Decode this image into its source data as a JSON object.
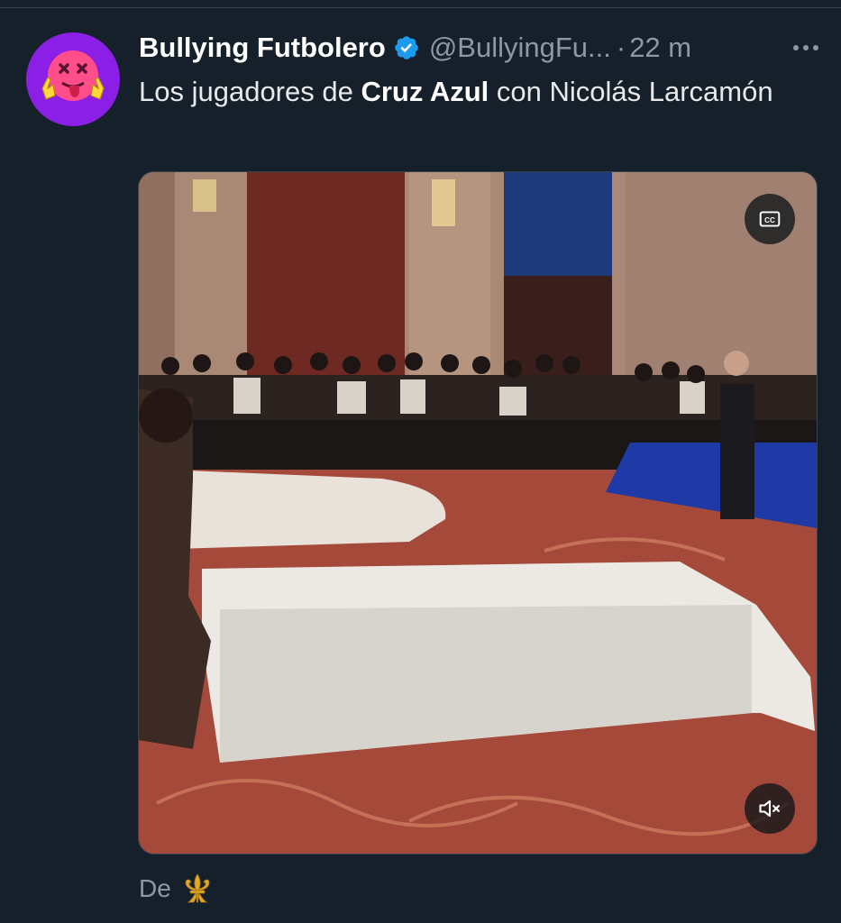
{
  "tweet": {
    "author": {
      "display_name": "Bullying Futbolero",
      "handle": "@BullyingFu...",
      "verified": true,
      "avatar_icon": "dizzy-tongue-face-icon"
    },
    "separator": "·",
    "time": "22 m",
    "text": {
      "part1": "Los jugadores de ",
      "bold": "Cruz Azul",
      "part2": " con Nicolás Larcamón"
    },
    "media": {
      "type": "video",
      "captions_icon": "cc-icon",
      "sound_icon": "muted-speaker-icon"
    },
    "footer": {
      "text": "De",
      "icon": "fleur-de-lis-icon"
    }
  },
  "colors": {
    "background": "#15202b",
    "text": "#e7e9ea",
    "muted": "#8b98a5",
    "verified": "#1d9bf0",
    "avatar_bg": "#8b1fe6",
    "fleur": "#e0a825"
  }
}
